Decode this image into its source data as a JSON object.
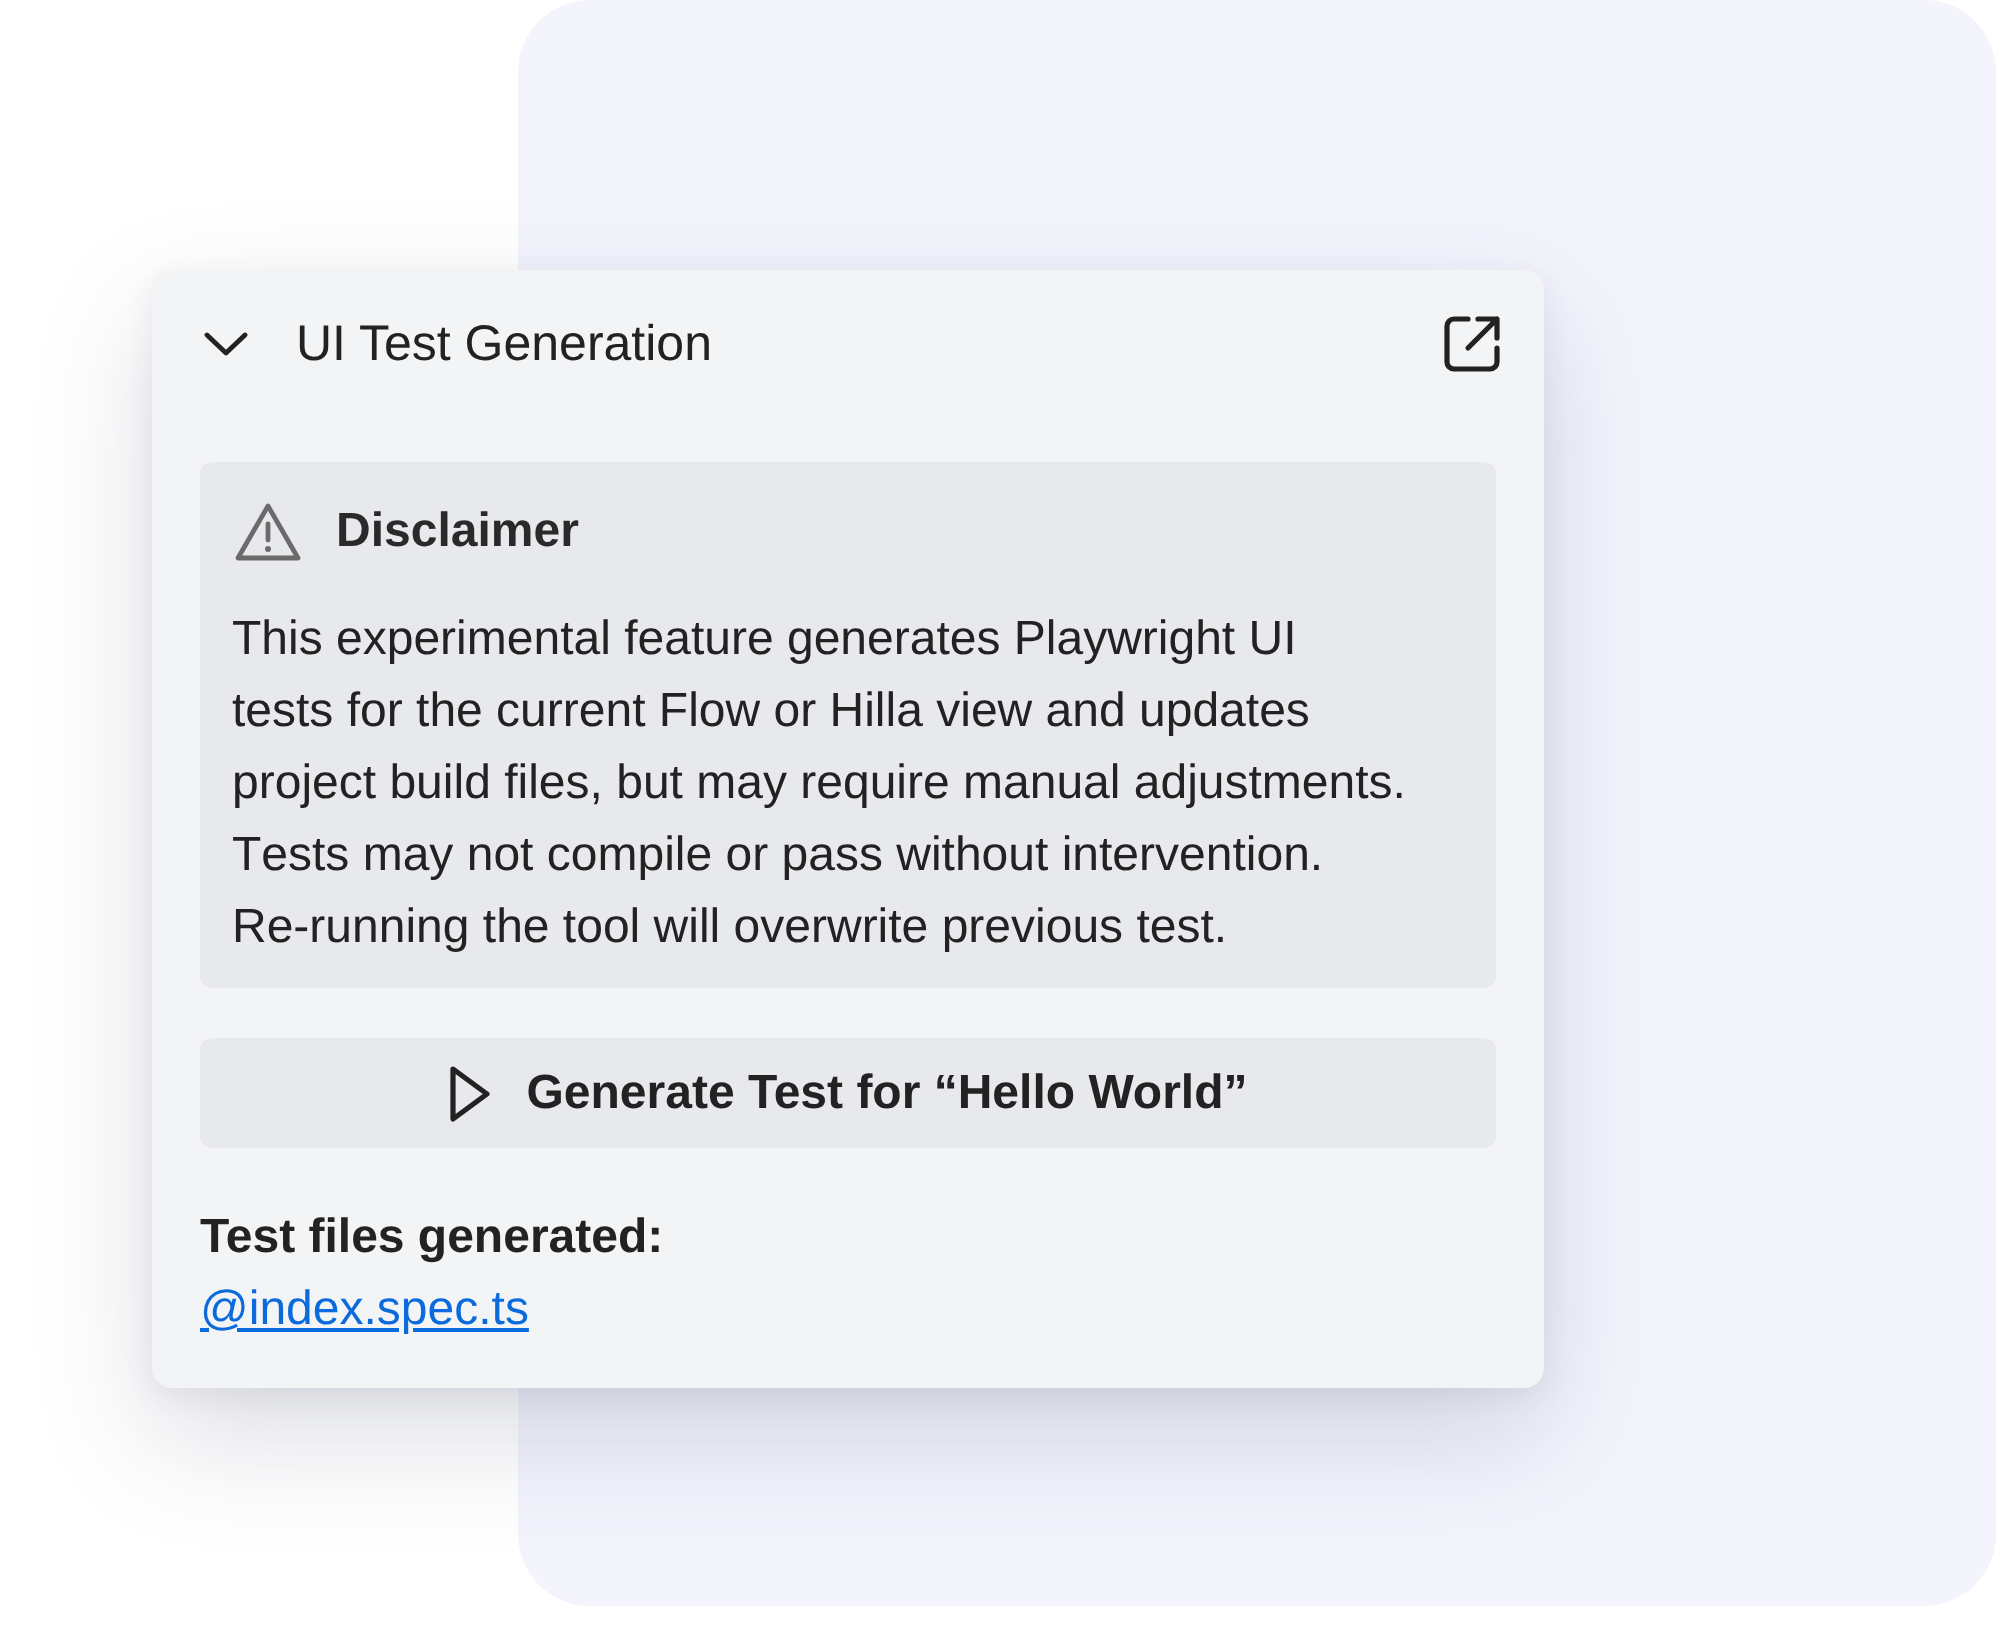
{
  "panel": {
    "title": "UI Test Generation",
    "expanded": true
  },
  "disclaimer": {
    "title": "Disclaimer",
    "text": "This experimental feature generates Playwright UI tests for the current Flow or Hilla view and updates project build files, but may require manual adjustments. Tests may not compile or pass without intervention. Re-running the tool will overwrite previous test."
  },
  "generate_button": {
    "label": "Generate Test for “Hello World”"
  },
  "result": {
    "label": "Test files generated:",
    "link": "@index.spec.ts"
  }
}
